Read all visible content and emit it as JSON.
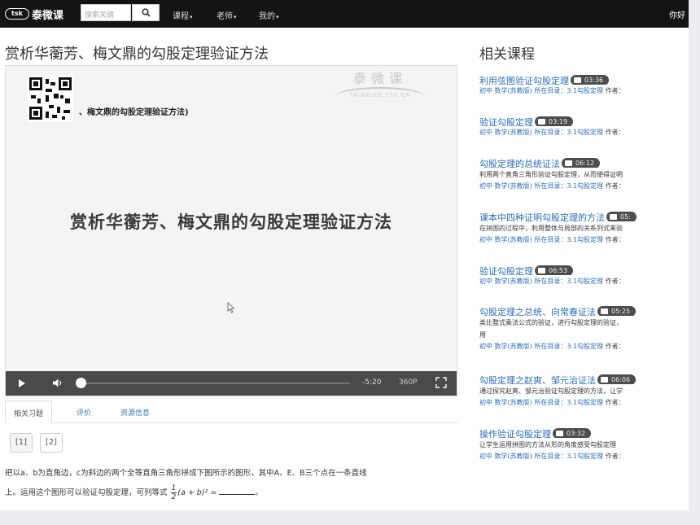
{
  "navbar": {
    "logo_badge": "tsk",
    "logo_text": "泰微课",
    "search_placeholder": "搜索关键",
    "menu": [
      "课程",
      "老师",
      "我的"
    ],
    "right_text": "你好"
  },
  "page": {
    "title": "赏析华蘅芳、梅文鼎的勾股定理验证方法"
  },
  "player": {
    "watermark_name": "泰微课",
    "watermark_url": "TAIWEIKE.TSK.CN",
    "qr_caption": "、梅文鼎的勾股定理验证方法)",
    "video_title": "赏析华蘅芳、梅文鼎的勾股定理验证方法",
    "time": "-5:20",
    "quality": "360P",
    "progress": 0.0
  },
  "tabs": [
    "相关习题",
    "评价",
    "资源信息"
  ],
  "question_buttons": [
    "[1]",
    "[2]"
  ],
  "question": {
    "line1": "把以a、b为直角边，c为斜边的两个全等直角三角形拼成下图所示的图形，其中A、E、B三个点在一条直线",
    "line2_prefix": "上。运用这个图形可以验证勾股定理，可列等式",
    "frac_num": "1",
    "frac_den": "2",
    "expr": "(a + b)² =",
    "line2_suffix": "。"
  },
  "related": {
    "title": "相关课程",
    "meta_prefix": "初中 数学(苏教版) 所在目录：",
    "meta_catalog": "3.1勾股定理",
    "meta_author": "作者：",
    "items": [
      {
        "title": "利用弦图验证勾股定理",
        "duration": "03:36",
        "desc": []
      },
      {
        "title": "验证勾股定理",
        "duration": "03:19",
        "desc": []
      },
      {
        "title": "勾股定理的总统证法",
        "duration": "06:12",
        "desc": [
          "利用两个直角三角形验证勾股定理，从而使得证明"
        ]
      },
      {
        "title": "课本中四种证明勾股定理的方法",
        "duration": "05:",
        "desc": [
          "在拼图的过程中，利用整体与局部的关系列式来验"
        ]
      },
      {
        "title": "验证勾股定理",
        "duration": "06:53",
        "desc": []
      },
      {
        "title": "勾股定理之总统、向常春证法",
        "duration": "05:25",
        "desc": [
          "类比整式乘法公式的验证，进行勾股定理的验证，",
          "用"
        ]
      },
      {
        "title": "勾股定理之赵爽、邹元治证法",
        "duration": "06:06",
        "desc": [
          "通过探究赵爽、邹元治验证勾股定理的方法，让学"
        ]
      },
      {
        "title": "操作验证勾股定理",
        "duration": "03:32",
        "desc": [
          "让学生运用拼图的方法从形的角度感受勾股定理"
        ]
      }
    ]
  }
}
